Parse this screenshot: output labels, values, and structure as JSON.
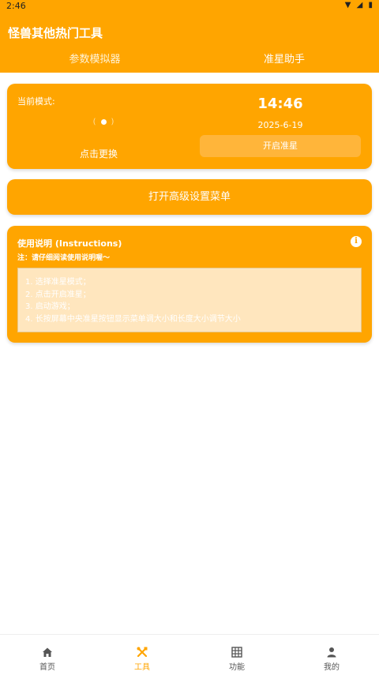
{
  "status_bar": {
    "time": "2:46"
  },
  "header": {
    "title": "怪兽其他热门工具",
    "tabs": [
      {
        "label": "参数模拟器",
        "selected": false
      },
      {
        "label": "准星助手",
        "selected": true
      }
    ]
  },
  "mode_card": {
    "mode_label": "当前模式:",
    "change_label": "点击更换",
    "clock": "14:46",
    "date": "2025-6-19",
    "aim_button_label": "开启准星"
  },
  "advanced_menu_label": "打开高级设置菜单",
  "instructions": {
    "title": "使用说明 (Instructions)",
    "note": "注：请仔细阅读使用说明喔～",
    "steps": [
      "1. 选择准星模式；",
      "2. 点击开启准星；",
      "3. 启动游戏；",
      "4. 长按屏幕中央准星按钮显示菜单调大小和长度大小调节大小"
    ]
  },
  "bottom_nav": {
    "items": [
      {
        "label": "首页",
        "icon": "home-icon",
        "active": false
      },
      {
        "label": "工具",
        "icon": "tools-icon",
        "active": true
      },
      {
        "label": "功能",
        "icon": "grid-icon",
        "active": false
      },
      {
        "label": "我的",
        "icon": "person-icon",
        "active": false
      }
    ]
  },
  "colors": {
    "accent": "#FFA500",
    "instruction_box": "#FFE6BE",
    "nav_text": "#555555"
  }
}
